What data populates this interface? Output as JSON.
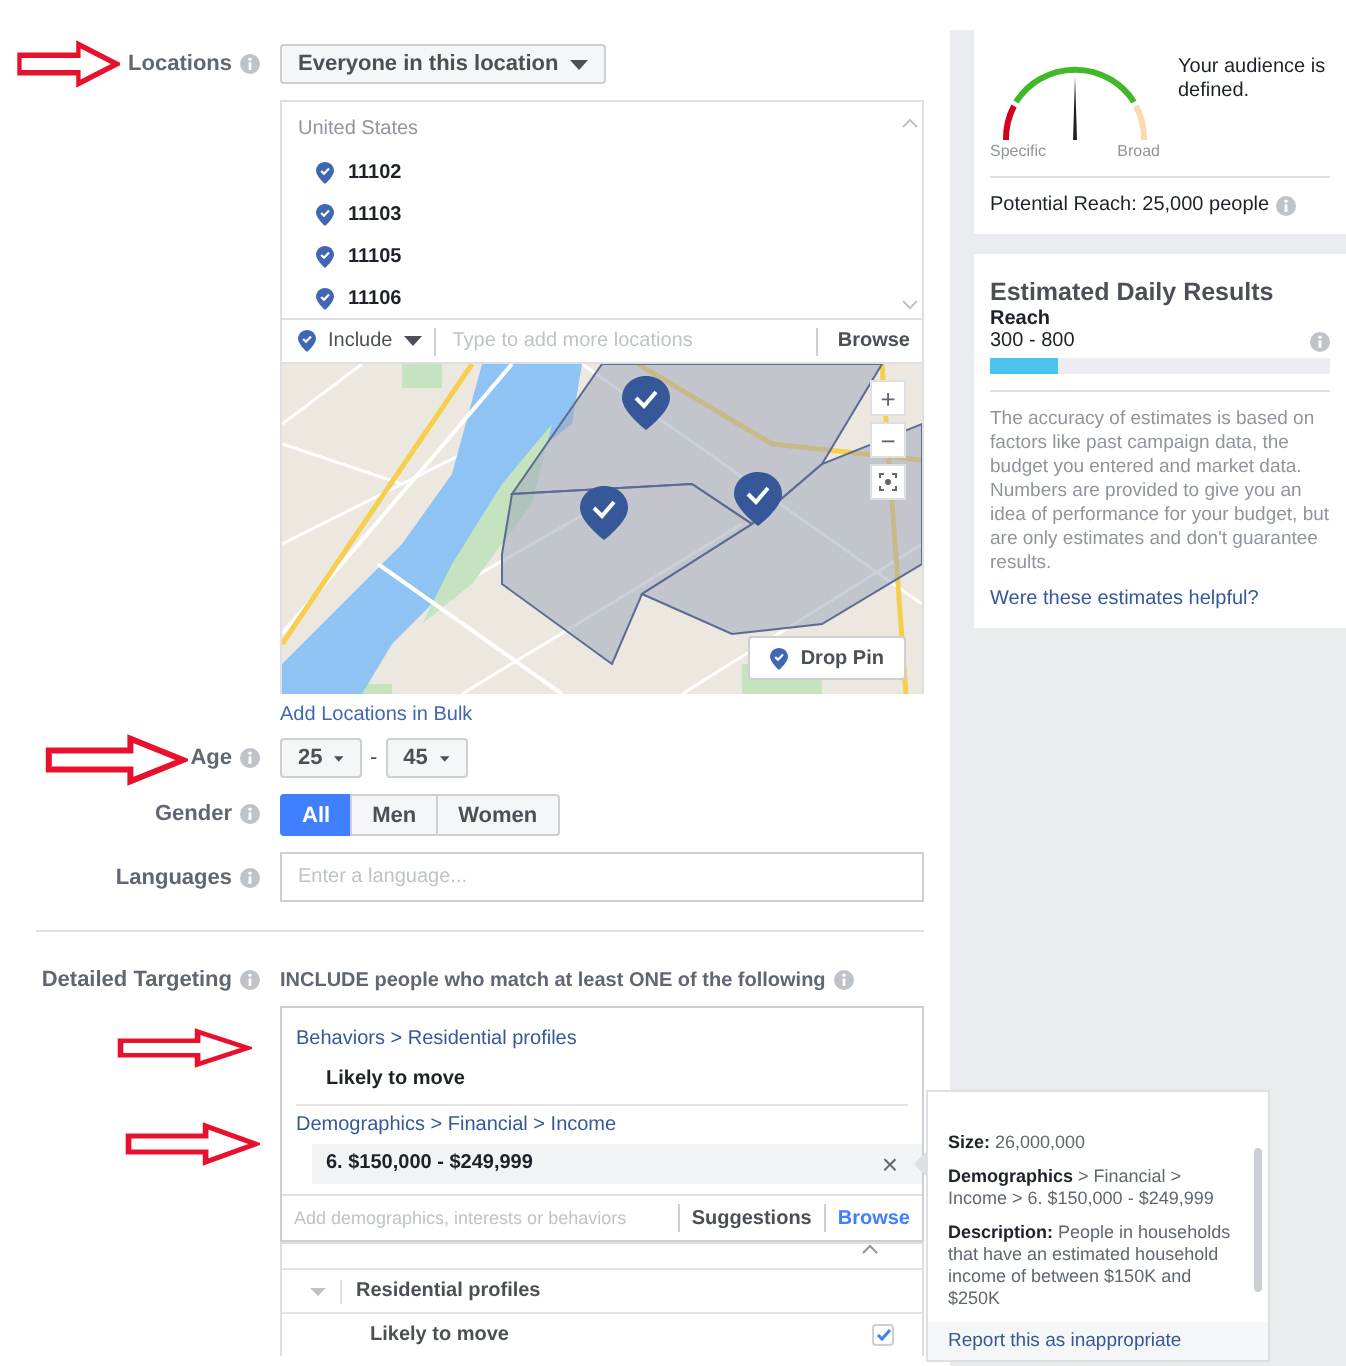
{
  "locations": {
    "label": "Locations",
    "audience_select": "Everyone in this location",
    "country": "United States",
    "items": [
      "11102",
      "11103",
      "11105",
      "11106"
    ],
    "include_select": "Include",
    "placeholder": "Type to add more locations",
    "browse": "Browse",
    "map": {
      "zoom_in": "+",
      "zoom_out": "−",
      "drop_pin": "Drop Pin"
    },
    "bulk_link": "Add Locations in Bulk"
  },
  "age": {
    "label": "Age",
    "min": "25",
    "separator": "-",
    "max": "45"
  },
  "gender": {
    "label": "Gender",
    "options": [
      {
        "label": "All",
        "selected": true
      },
      {
        "label": "Men",
        "selected": false
      },
      {
        "label": "Women",
        "selected": false
      }
    ]
  },
  "languages": {
    "label": "Languages",
    "placeholder": "Enter a language..."
  },
  "detailed_targeting": {
    "label": "Detailed Targeting",
    "instruction": "INCLUDE people who match at least ONE of the following",
    "groups": [
      {
        "path": "Behaviors > Residential profiles",
        "items": [
          {
            "label": "Likely to move",
            "highlighted": false
          }
        ]
      },
      {
        "path": "Demographics > Financial > Income",
        "items": [
          {
            "label": "6. $150,000 - $249,999",
            "highlighted": true,
            "remove": "×"
          }
        ]
      }
    ],
    "placeholder": "Add demographics, interests or behaviors",
    "tabs": [
      {
        "label": "Suggestions",
        "selected": false
      },
      {
        "label": "Browse",
        "selected": true
      }
    ],
    "browse_list": [
      {
        "kind": "category",
        "label": "Residential profiles",
        "expanded": true
      },
      {
        "kind": "option",
        "label": "Likely to move",
        "checked": true
      }
    ]
  },
  "tooltip": {
    "size": "**Size:** 26,000,000",
    "path": "**Demographics** > Financial > Income > 6. $150,000 - $249,999",
    "description": "**Description:** People in households that have an estimated household income of between $150K and $250K",
    "report_link": "Report this as inappropriate"
  },
  "audience": {
    "gauge_low": "Specific",
    "gauge_high": "Broad",
    "message": "Your audience is defined.",
    "potential_reach": "Potential Reach: 25,000 people"
  },
  "estimates": {
    "title": "Estimated Daily Results",
    "metric": "Reach",
    "range": "300 - 800",
    "level": 0.2,
    "note": "The accuracy of estimates is based on factors like past campaign data, the budget you entered and market data. Numbers are provided to give you an idea of performance for your budget, but are only estimates and don't guarantee results.",
    "feedback_link": "Were these estimates helpful?"
  }
}
